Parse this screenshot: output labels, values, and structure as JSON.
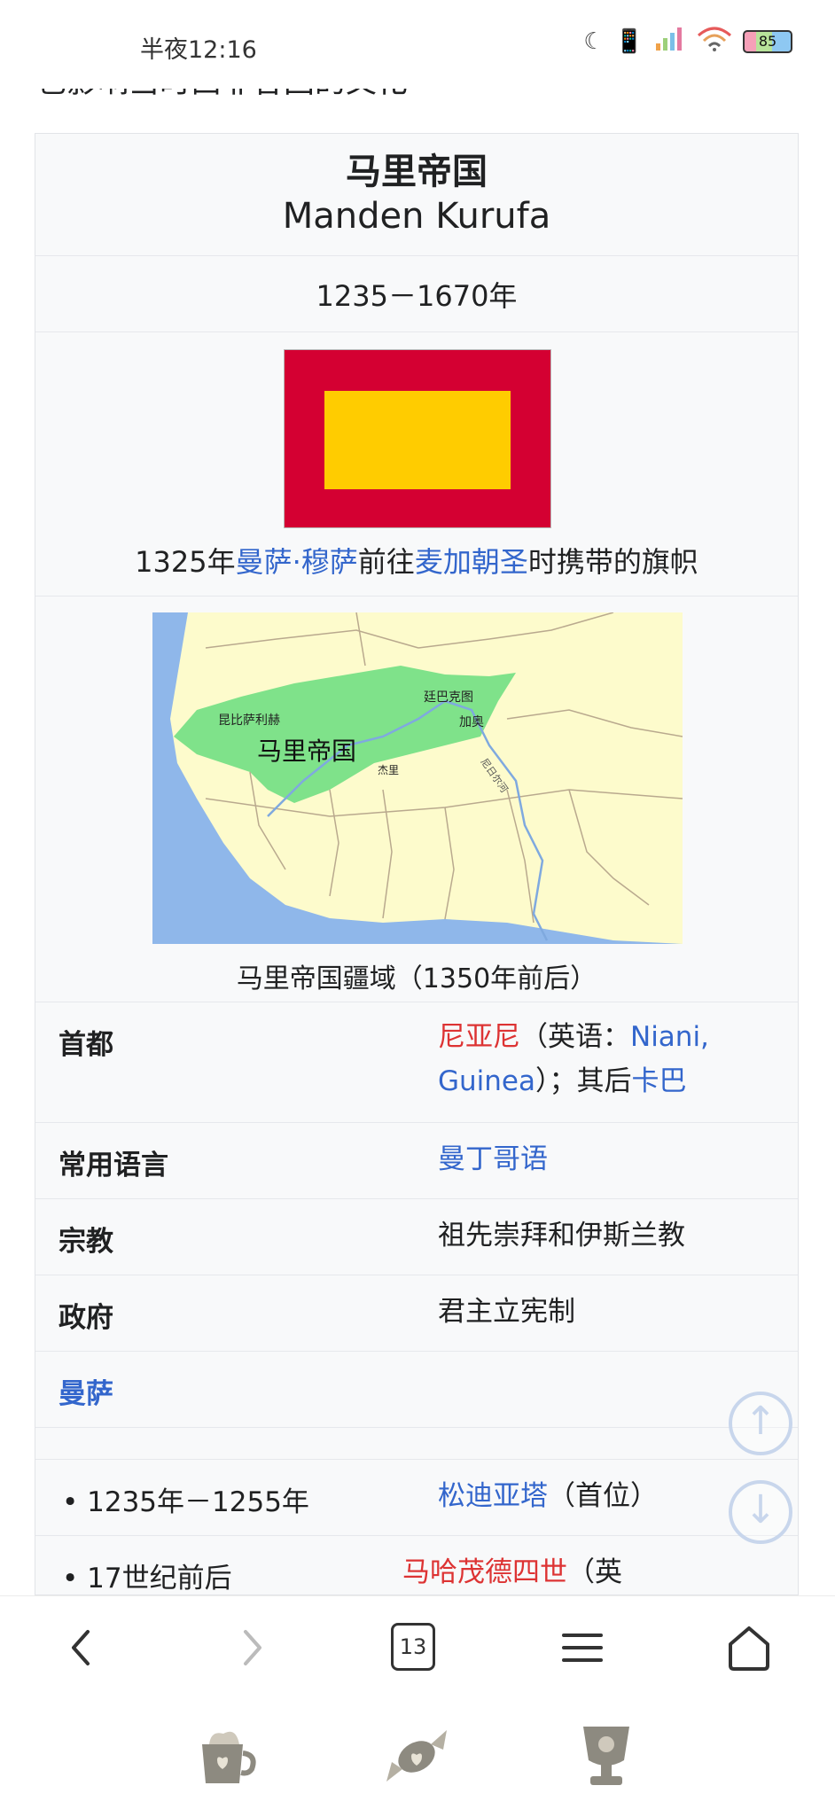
{
  "status_bar": {
    "time": "半夜12:16",
    "battery": "85"
  },
  "page": {
    "prev_line": "也影响当时西非各国的文化"
  },
  "infobox": {
    "title_cn": "马里帝国",
    "title_native": "Manden Kurufa",
    "years": "1235－1670年",
    "flag_caption": {
      "prefix": "1325年",
      "link1": "曼萨·穆萨",
      "middle": "前往",
      "link2": "麦加朝圣",
      "suffix": "时携带的旗帜"
    },
    "map": {
      "labels": {
        "empire": "马里帝国",
        "kumbi": "昆比萨利赫",
        "timbuktu": "廷巴克图",
        "gao": "加奥",
        "djenne": "杰里",
        "niger": "尼日尔河"
      }
    },
    "map_caption": "马里帝国疆域（1350年前后）",
    "capital": {
      "label": "首都",
      "value_link1": "尼亚尼",
      "value_text1": "（英语：",
      "value_link2": "Niani, Guinea",
      "value_text2": "）；其后",
      "value_link3": "卡巴"
    },
    "language": {
      "label": "常用语言",
      "value": "曼丁哥语"
    },
    "religion": {
      "label": "宗教",
      "value": "祖先崇拜和伊斯兰教"
    },
    "government": {
      "label": "政府",
      "value": "君主立宪制"
    },
    "mansa": {
      "label": "曼萨"
    },
    "rulers": [
      {
        "period": "• 1235年－1255年",
        "name": "松迪亚塔",
        "note": "（首位）"
      },
      {
        "period": "• 17世纪前后",
        "name": "马哈茂德四世",
        "note": "（英"
      }
    ]
  },
  "bottom_nav": {
    "tab_count": "13"
  },
  "colors": {
    "link": "#3366cc",
    "redlink": "#dd3333",
    "flag_red": "#d40032",
    "flag_yellow": "#ffcc00"
  }
}
